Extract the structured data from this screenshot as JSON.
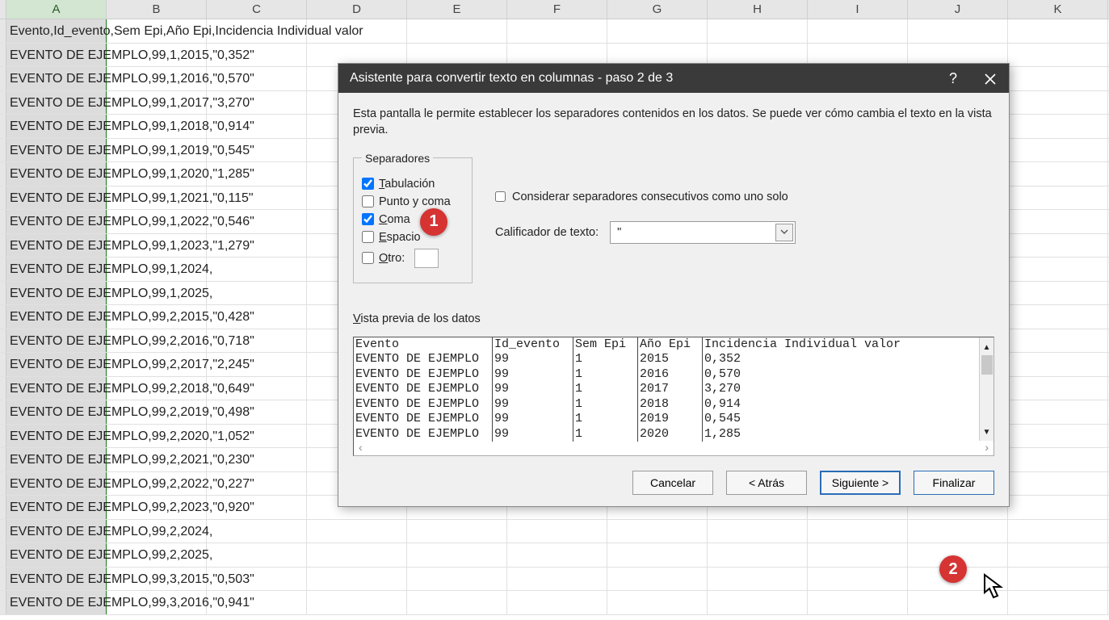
{
  "columns": [
    "A",
    "B",
    "C",
    "D",
    "E",
    "F",
    "G",
    "H",
    "I",
    "J",
    "K"
  ],
  "rows": [
    "Evento,Id_evento,Sem Epi,Año Epi,Incidencia Individual valor",
    "EVENTO DE EJEMPLO,99,1,2015,\"0,352\"",
    "EVENTO DE EJEMPLO,99,1,2016,\"0,570\"",
    "EVENTO DE EJEMPLO,99,1,2017,\"3,270\"",
    "EVENTO DE EJEMPLO,99,1,2018,\"0,914\"",
    "EVENTO DE EJEMPLO,99,1,2019,\"0,545\"",
    "EVENTO DE EJEMPLO,99,1,2020,\"1,285\"",
    "EVENTO DE EJEMPLO,99,1,2021,\"0,115\"",
    "EVENTO DE EJEMPLO,99,1,2022,\"0,546\"",
    "EVENTO DE EJEMPLO,99,1,2023,\"1,279\"",
    "EVENTO DE EJEMPLO,99,1,2024,",
    "EVENTO DE EJEMPLO,99,1,2025,",
    "EVENTO DE EJEMPLO,99,2,2015,\"0,428\"",
    "EVENTO DE EJEMPLO,99,2,2016,\"0,718\"",
    "EVENTO DE EJEMPLO,99,2,2017,\"2,245\"",
    "EVENTO DE EJEMPLO,99,2,2018,\"0,649\"",
    "EVENTO DE EJEMPLO,99,2,2019,\"0,498\"",
    "EVENTO DE EJEMPLO,99,2,2020,\"1,052\"",
    "EVENTO DE EJEMPLO,99,2,2021,\"0,230\"",
    "EVENTO DE EJEMPLO,99,2,2022,\"0,227\"",
    "EVENTO DE EJEMPLO,99,2,2023,\"0,920\"",
    "EVENTO DE EJEMPLO,99,2,2024,",
    "EVENTO DE EJEMPLO,99,2,2025,",
    "EVENTO DE EJEMPLO,99,3,2015,\"0,503\"",
    "EVENTO DE EJEMPLO,99,3,2016,\"0,941\""
  ],
  "dialog": {
    "title": "Asistente para convertir texto en columnas - paso 2 de 3",
    "intro": "Esta pantalla le permite establecer los separadores contenidos en los datos. Se puede ver cómo cambia el texto en la vista previa.",
    "sep_legend": "Separadores",
    "sep_tab": "Tabulación",
    "sep_semi": "Punto y coma",
    "sep_comma": "Coma",
    "sep_space": "Espacio",
    "sep_other": "Otro:",
    "consecutive": "Considerar separadores consecutivos como uno solo",
    "qualifier_label": "Calificador de texto:",
    "qualifier_value": "\"",
    "preview_label": "Vista previa de los datos",
    "preview_headers": [
      "Evento",
      "Id_evento",
      "Sem Epi",
      "Año Epi",
      "Incidencia Individual valor"
    ],
    "preview_rows": [
      [
        "EVENTO DE EJEMPLO",
        "99",
        "1",
        "2015",
        "0,352"
      ],
      [
        "EVENTO DE EJEMPLO",
        "99",
        "1",
        "2016",
        "0,570"
      ],
      [
        "EVENTO DE EJEMPLO",
        "99",
        "1",
        "2017",
        "3,270"
      ],
      [
        "EVENTO DE EJEMPLO",
        "99",
        "1",
        "2018",
        "0,914"
      ],
      [
        "EVENTO DE EJEMPLO",
        "99",
        "1",
        "2019",
        "0,545"
      ],
      [
        "EVENTO DE EJEMPLO",
        "99",
        "1",
        "2020",
        "1,285"
      ]
    ],
    "btn_cancel": "Cancelar",
    "btn_back": "< Atrás",
    "btn_next": "Siguiente >",
    "btn_finish": "Finalizar"
  },
  "callouts": {
    "one": "1",
    "two": "2"
  }
}
